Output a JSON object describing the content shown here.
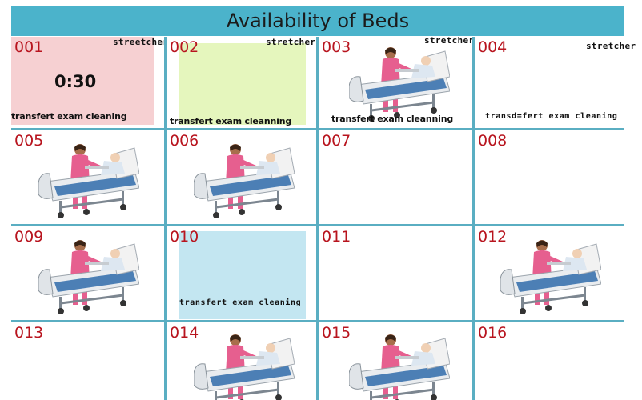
{
  "header": {
    "title": "Availability of Beds"
  },
  "beds": [
    {
      "number": "001",
      "stretcher": "streetcher",
      "timer": "0:30",
      "actions": "transfert  exam  cleaning"
    },
    {
      "number": "002",
      "stretcher": "stretcher",
      "actions": "transfert    exam    cleanning"
    },
    {
      "number": "003",
      "stretcher": "stretcher",
      "actions": "transfert   exam cleanning"
    },
    {
      "number": "004",
      "stretcher": "stretcher",
      "actions": "transd=fert  exam  cleaning"
    },
    {
      "number": "005"
    },
    {
      "number": "006"
    },
    {
      "number": "007"
    },
    {
      "number": "008"
    },
    {
      "number": "009"
    },
    {
      "number": "010",
      "actions": "transfert exam cleaning"
    },
    {
      "number": "011"
    },
    {
      "number": "012"
    },
    {
      "number": "013"
    },
    {
      "number": "014"
    },
    {
      "number": "015"
    },
    {
      "number": "016"
    }
  ],
  "colors": {
    "header_bg": "#4bb3cb",
    "grid_line": "#5aaec2",
    "bed_number": "#b8141e",
    "status_pink": "#f6d0d2",
    "status_green": "#e5f6bd",
    "status_blue": "#c3e6f1"
  },
  "illustration": "nurse-with-patient-in-hospital-bed"
}
